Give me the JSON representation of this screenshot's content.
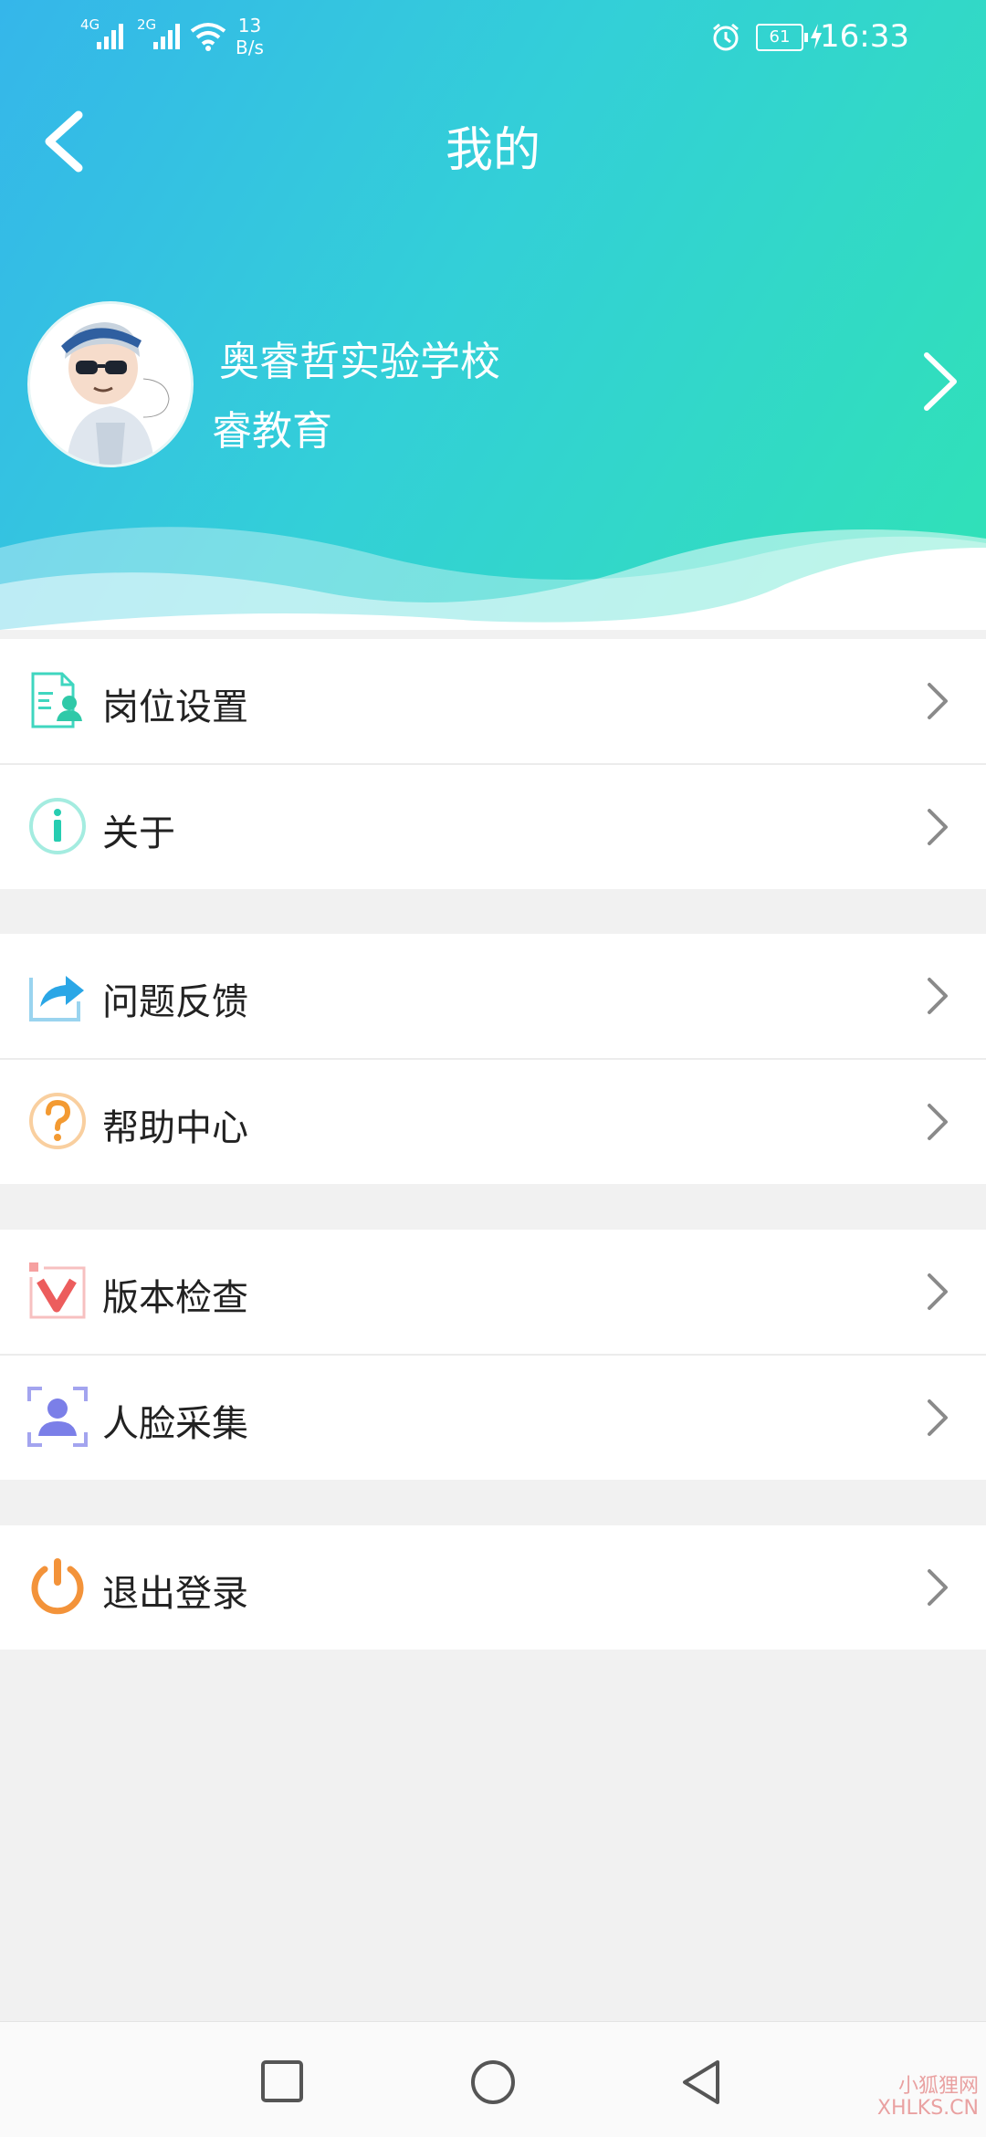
{
  "status_bar": {
    "signal_1": "4G",
    "signal_2": "2G",
    "net_speed_value": "13",
    "net_speed_unit": "B/s",
    "battery": "61",
    "time": "16:33"
  },
  "header": {
    "title": "我的",
    "back_icon": "chevron-left-icon"
  },
  "profile": {
    "school": "奥睿哲实验学校",
    "org": "睿教育",
    "arrow_icon": "chevron-right-icon"
  },
  "menu_groups": [
    [
      {
        "label": "岗位设置",
        "icon": "position-settings-icon"
      },
      {
        "label": "关于",
        "icon": "info-icon"
      }
    ],
    [
      {
        "label": "问题反馈",
        "icon": "feedback-icon"
      },
      {
        "label": "帮助中心",
        "icon": "help-icon"
      }
    ],
    [
      {
        "label": "版本检查",
        "icon": "version-check-icon"
      },
      {
        "label": "人脸采集",
        "icon": "face-capture-icon"
      }
    ],
    [
      {
        "label": "退出登录",
        "icon": "power-icon"
      }
    ]
  ],
  "watermark": {
    "line1": "小狐狸网",
    "line2": "XHLKS.CN"
  },
  "colors": {
    "header_start": "#35b6ea",
    "header_end": "#30e2b6",
    "background": "#f1f1f1"
  }
}
